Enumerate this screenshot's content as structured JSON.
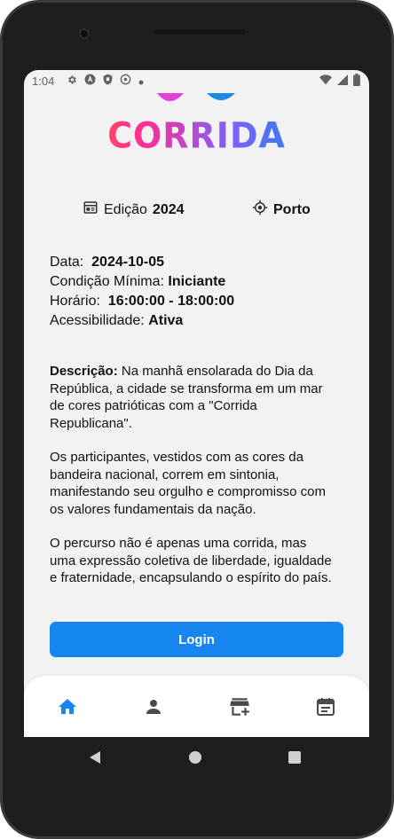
{
  "status_bar": {
    "time": "1:04",
    "icons_left": [
      "gear-icon",
      "a-badge-icon",
      "shield-icon",
      "at-icon",
      "dot-icon"
    ],
    "icons_right": [
      "wifi-icon",
      "signal-icon",
      "battery-icon"
    ]
  },
  "logo": {
    "text": "CORRIDA"
  },
  "meta": {
    "edition_label": "Edição",
    "edition_year": "2024",
    "location": "Porto"
  },
  "details": {
    "date_label": "Data:",
    "date_value": "2024-10-05",
    "condition_label": "Condição Mínima:",
    "condition_value": "Iniciante",
    "time_label": "Horário:",
    "time_value": "16:00:00 - 18:00:00",
    "accessibility_label": "Acessibilidade:",
    "accessibility_value": "Ativa"
  },
  "description": {
    "label": "Descrição:",
    "p1": "Na manhã ensolarada do Dia da República, a cidade se transforma em um mar de cores patrióticas com a \"Corrida Republicana\".",
    "p2": "Os participantes, vestidos com as cores da bandeira nacional, correm em sintonia, manifestando seu orgulho e compromisso com os valores fundamentais da nação.",
    "p3": "O percurso não é apenas uma corrida, mas uma expressão coletiva de liberdade, igualdade e fraternidade, encapsulando o espírito do país."
  },
  "login_button": {
    "label": "Login"
  },
  "tab_bar": {
    "tabs": [
      "home-icon",
      "person-icon",
      "add-event-icon",
      "calendar-icon"
    ],
    "active_color": "#1787ef",
    "inactive_color": "#4a4a4a"
  },
  "colors": {
    "accent": "#1787ef",
    "background": "#f2f2f2"
  }
}
